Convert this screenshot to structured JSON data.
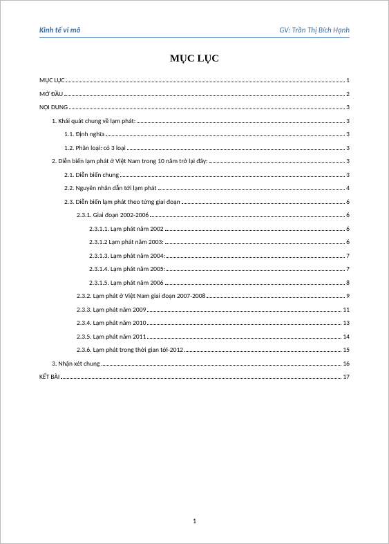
{
  "header": {
    "left": "Kinh tế vĩ mô",
    "right": "GV: Trần Thị Bích Hạnh"
  },
  "title": "MỤC LỤC",
  "page_number": "1",
  "toc": [
    {
      "level": 0,
      "label": "MỤC LỤC",
      "page": "1"
    },
    {
      "level": 0,
      "label": "MỞ ĐẦU",
      "page": "2"
    },
    {
      "level": 0,
      "label": "NỘI DUNG",
      "page": "3"
    },
    {
      "level": 1,
      "label": "1. Khái quát chung về lạm phát:",
      "page": "3"
    },
    {
      "level": 2,
      "label": "1.1. Định nghĩa",
      "page": "3"
    },
    {
      "level": 2,
      "label": "1.2. Phân loại: có 3 loại",
      "page": "3"
    },
    {
      "level": 1,
      "label": "2. Diễn biến lạm phát ở Việt Nam trong 10 năm trở lại đây:",
      "page": "3"
    },
    {
      "level": 2,
      "label": "2.1. Diễn biến chung",
      "page": "3"
    },
    {
      "level": 2,
      "label": "2.2. Nguyên nhân dẫn tới lạm phát",
      "page": "4"
    },
    {
      "level": 2,
      "label": "2.3. Diễn biến lạm phát theo từng giai đoạn",
      "page": "6"
    },
    {
      "level": 3,
      "label": "2.3.1. Giai đoạn 2002-2006",
      "page": "6"
    },
    {
      "level": 4,
      "label": "2.3.1.1. Lạm phát năm 2002",
      "page": "6"
    },
    {
      "level": 4,
      "label": "2.3.1.2 Lạm phát năm 2003:",
      "page": "6"
    },
    {
      "level": 4,
      "label": "2.3.1.3. Lạm phát năm 2004:",
      "page": "7"
    },
    {
      "level": 4,
      "label": "2.3.1.4. Lạm phát năm 2005:",
      "page": "7"
    },
    {
      "level": 4,
      "label": "2.3.1.5. Lạm phát năm 2006",
      "page": "8"
    },
    {
      "level": 3,
      "label": "2.3.2. Lạm phát ở Việt Nam giai đoạn 2007-2008",
      "page": "9"
    },
    {
      "level": 3,
      "label": "2.3.3. Lạm phát năm 2009",
      "page": "11"
    },
    {
      "level": 3,
      "label": "2.3.4. Lạm phát năm 2010",
      "page": "13"
    },
    {
      "level": 3,
      "label": "2.3.5. Lạm phát năm 2011",
      "page": "14"
    },
    {
      "level": 3,
      "label": "2.3.6. Lạm phát trong thời gian tới-2012",
      "page": "15"
    },
    {
      "level": 1,
      "label": "3. Nhận xét chung",
      "page": "16"
    },
    {
      "level": 0,
      "label": "KẾT BÀI",
      "page": "17"
    }
  ]
}
